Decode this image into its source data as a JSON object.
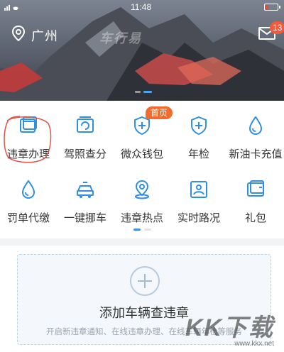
{
  "status_bar": {
    "time": "11:48"
  },
  "header": {
    "city": "广州",
    "banner_text": "车行易",
    "mail_badge": "13"
  },
  "banner": {
    "dots": 2,
    "active_dot": 1
  },
  "grid": {
    "hot_badge": "首页",
    "row1": [
      {
        "label": "违章办理",
        "icon": "violation-handle-icon"
      },
      {
        "label": "驾照查分",
        "icon": "license-points-icon"
      },
      {
        "label": "微众钱包",
        "icon": "wallet-shield-icon"
      },
      {
        "label": "年检",
        "icon": "annual-inspection-shield-icon"
      },
      {
        "label": "新油卡充值",
        "icon": "oil-drop-icon"
      }
    ],
    "row2": [
      {
        "label": "罚单代缴",
        "icon": "fine-payment-drop-icon"
      },
      {
        "label": "一键挪车",
        "icon": "move-car-icon"
      },
      {
        "label": "违章热点",
        "icon": "hotspot-location-icon"
      },
      {
        "label": "实时路况",
        "icon": "traffic-map-icon"
      },
      {
        "label": "礼包",
        "icon": "gift-pack-icon"
      }
    ],
    "page_count": 2,
    "active_page": 1
  },
  "add_vehicle": {
    "title": "添加车辆查违章",
    "subtitle": "开启新违章通知、在线违章办理、在线车辆年检等服务"
  },
  "watermark": {
    "big": "KK下载",
    "small": "www.kkx.net"
  },
  "colors": {
    "accent": "#2f8fe3",
    "badge": "#f25a3c",
    "hot": "#f06b2c"
  }
}
